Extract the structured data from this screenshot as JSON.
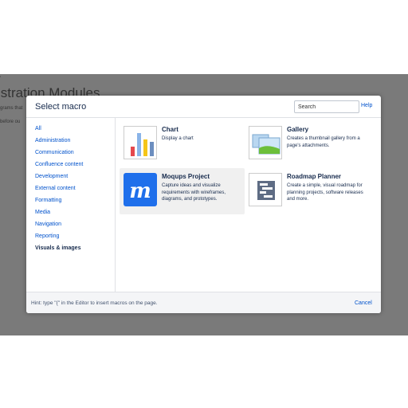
{
  "background": {
    "page_title": "istration Modules",
    "line1": "grams that",
    "line2": "before ou"
  },
  "dialog": {
    "title": "Select macro",
    "search": {
      "placeholder": "Search",
      "value": ""
    },
    "help_label": "Help",
    "categories": [
      {
        "label": "All",
        "active": false
      },
      {
        "label": "Administration",
        "active": false
      },
      {
        "label": "Communication",
        "active": false
      },
      {
        "label": "Confluence content",
        "active": false
      },
      {
        "label": "Development",
        "active": false
      },
      {
        "label": "External content",
        "active": false
      },
      {
        "label": "Formatting",
        "active": false
      },
      {
        "label": "Media",
        "active": false
      },
      {
        "label": "Navigation",
        "active": false
      },
      {
        "label": "Reporting",
        "active": false
      },
      {
        "label": "Visuals & images",
        "active": true
      }
    ],
    "macros": [
      {
        "title": "Chart",
        "description": "Display a chart",
        "icon": "bar-chart-icon"
      },
      {
        "title": "Gallery",
        "description": "Creates a thumbnail gallery from a page's attachments.",
        "icon": "gallery-icon"
      },
      {
        "title": "Moqups Project",
        "description": "Capture ideas and visualize requirements with wireframes, diagrams, and prototypes.",
        "icon": "moqups-icon"
      },
      {
        "title": "Roadmap Planner",
        "description": "Create a simple, visual roadmap for planning projects, software releases and more.",
        "icon": "roadmap-icon"
      }
    ],
    "footer": {
      "hint": "Hint: type \"{\" in the Editor to insert macros on the page.",
      "cancel_label": "Cancel"
    }
  },
  "colors": {
    "overlay": "#7a7a7a",
    "link": "#0052cc",
    "text": "#172b4d",
    "moqups_blue": "#1f6feb"
  }
}
